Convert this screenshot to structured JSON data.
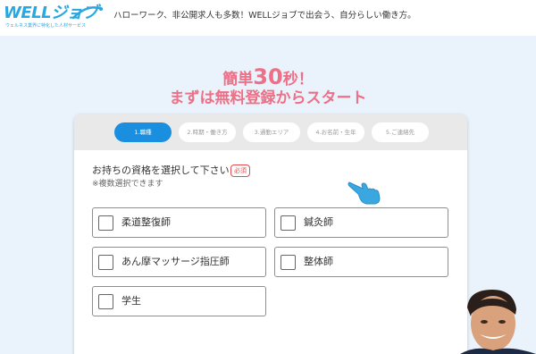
{
  "header": {
    "logo_text": "WELLジョブ",
    "logo_subtext": "ウェルネス業界に特化した人材サービス",
    "tagline": "ハローワーク、非公開求人も多数！WELLジョブで出会う、自分らしい働き方。"
  },
  "headline": {
    "line1_prefix": "簡単",
    "line1_number": "30",
    "line1_suffix": "秒！",
    "line2": "まずは無料登録からスタート"
  },
  "steps": [
    {
      "label": "1.職種",
      "active": true
    },
    {
      "label": "2.時期・働き方",
      "active": false
    },
    {
      "label": "3.通勤エリア",
      "active": false
    },
    {
      "label": "4.お名前・生年",
      "active": false
    },
    {
      "label": "5.ご連絡先",
      "active": false
    }
  ],
  "form": {
    "question": "お持ちの資格を選択して下さい",
    "required_badge": "必須",
    "note": "※複数選択できます",
    "options": [
      {
        "label": "柔道整復師",
        "checked": false
      },
      {
        "label": "鍼灸師",
        "checked": false
      },
      {
        "label": "あん摩マッサージ指圧師",
        "checked": false
      },
      {
        "label": "整体師",
        "checked": false
      },
      {
        "label": "学生",
        "checked": false
      }
    ]
  },
  "colors": {
    "brand_blue": "#2aa7e0",
    "active_step": "#1a8fe0",
    "headline_pink": "#ee6f86",
    "required_red": "#e54b4b",
    "page_bg": "#eaf3fb"
  },
  "icons": {
    "pointer": "pointing-hand-icon",
    "logo_mark": "swoosh-icon"
  }
}
